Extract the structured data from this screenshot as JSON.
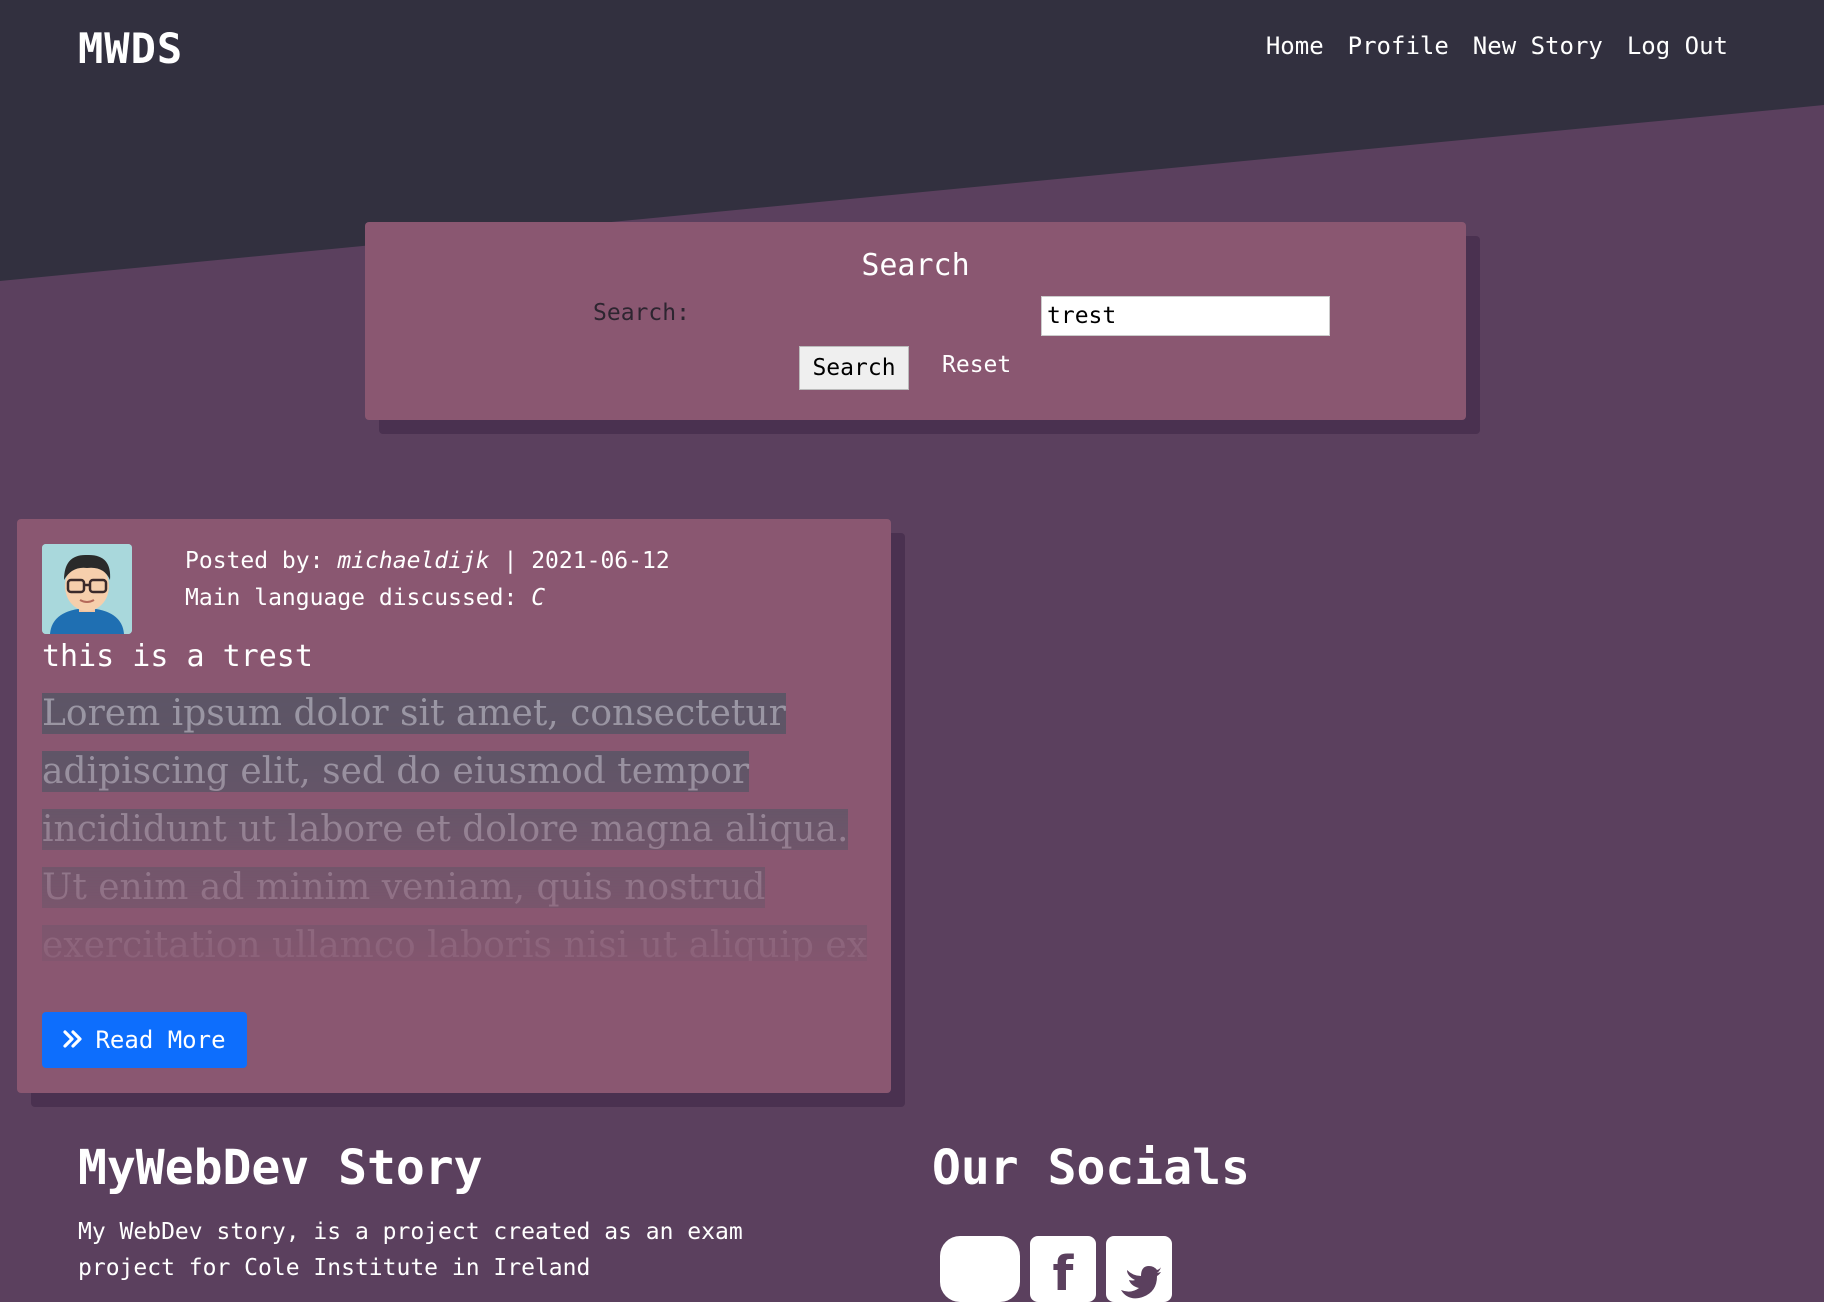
{
  "navbar": {
    "brand": "MWDS",
    "links": [
      "Home",
      "Profile",
      "New Story",
      "Log Out"
    ]
  },
  "search": {
    "title": "Search",
    "label": "Search:",
    "value": "trest",
    "button_label": "Search",
    "reset_label": "Reset"
  },
  "story": {
    "posted_by_prefix": "Posted by: ",
    "author": "michaeldijk",
    "separator": " | ",
    "date": "2021-06-12",
    "language_prefix": "Main language discussed: ",
    "language": "C",
    "title": "this is a trest",
    "excerpt": "Lorem ipsum dolor sit amet, consectetur adipiscing elit, sed do eiusmod tempor incididunt ut labore et dolore magna aliqua. Ut enim ad minim veniam, quis nostrud exercitation ullamco laboris nisi ut aliquip ex ea",
    "read_more_label": "Read More",
    "read_more_icon": "double-chevron-right-icon",
    "avatar_icon": "user-avatar"
  },
  "footer": {
    "about_title": "MyWebDev Story",
    "about_text": "My WebDev story, is a project created as an exam project for Cole Institute in Ireland",
    "socials_title": "Our Socials",
    "social_icons": [
      "instagram-icon",
      "facebook-icon",
      "twitter-icon"
    ]
  },
  "colors": {
    "header_bg": "#32303f",
    "page_bg": "#5b405e",
    "panel_bg": "#8a5771",
    "button_blue": "#0d6efd"
  }
}
